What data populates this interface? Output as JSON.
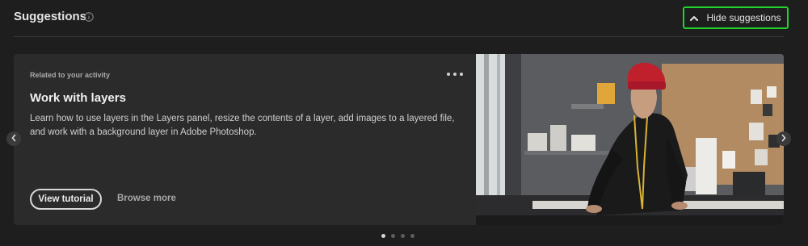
{
  "header": {
    "title": "Suggestions",
    "info_icon": "info-icon",
    "hide_button": {
      "label": "Hide suggestions",
      "icon": "chevron-up-icon",
      "highlight_color": "#22d12c"
    }
  },
  "card": {
    "kicker": "Related to your activity",
    "more_icon": "more-horizontal-icon",
    "title": "Work with layers",
    "description": "Learn how to use layers in the Layers panel, resize the contents of a layer, add images to a layered file, and work with a background layer in Adobe Photoshop.",
    "primary_button": "View tutorial",
    "secondary_link": "Browse more",
    "image": "photo of a person in a red beanie working at a studio desk"
  },
  "carousel": {
    "prev_icon": "chevron-left-icon",
    "next_icon": "chevron-right-icon",
    "dots_total": 4,
    "active_index": 0
  },
  "colors": {
    "background": "#1e1e1e",
    "card": "#2b2b2b",
    "accent_beanie": "#c0202c"
  }
}
